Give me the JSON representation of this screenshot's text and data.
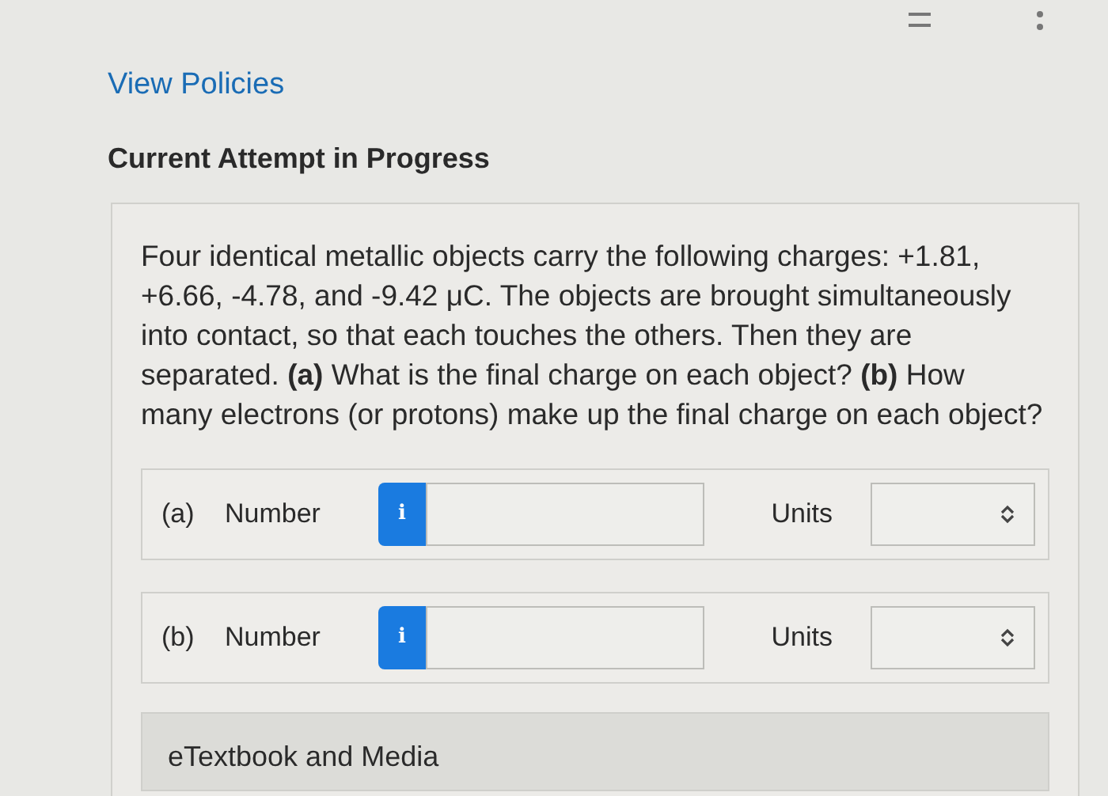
{
  "links": {
    "policies": "View Policies"
  },
  "heading": "Current Attempt in Progress",
  "question": "Four identical metallic objects carry the following charges: +1.81, +6.66, -4.78, and -9.42 μC. The objects are brought simultaneously into contact, so that each touches the others. Then they are separated. **(a)** What is the final charge on each object? **(b)** How many electrons (or protons) make up the final charge on each object?",
  "answers": [
    {
      "part": "(a)",
      "label": "Number",
      "info": "i",
      "units_label": "Units"
    },
    {
      "part": "(b)",
      "label": "Number",
      "info": "i",
      "units_label": "Units"
    }
  ],
  "resources": {
    "title": "eTextbook and Media"
  }
}
